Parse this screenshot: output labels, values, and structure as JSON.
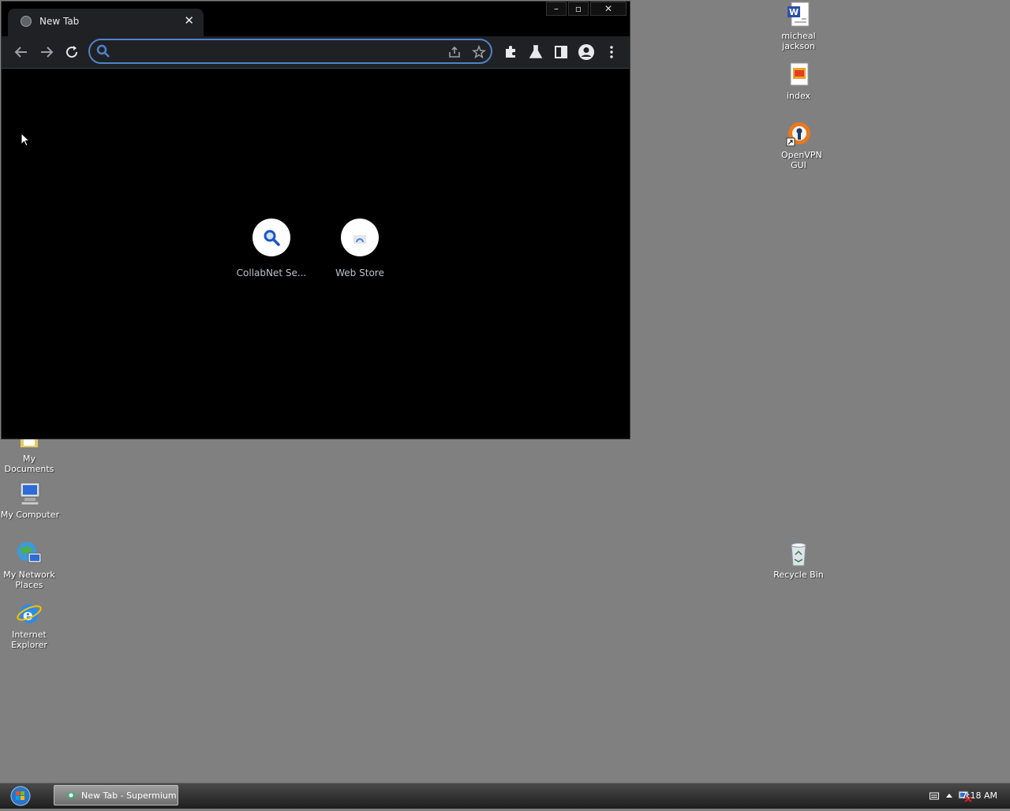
{
  "browser": {
    "tab_title": "New Tab",
    "omnibox_value": "",
    "shortcuts": [
      {
        "label": "CollabNet Se...",
        "icon": "magnifier-icon"
      },
      {
        "label": "Web Store",
        "icon": "web-store-icon"
      }
    ]
  },
  "desktop": {
    "icons": [
      {
        "label": "micheal jackson",
        "icon": "word-document-icon"
      },
      {
        "label": "index",
        "icon": "html-file-icon"
      },
      {
        "label": "OpenVPN GUI",
        "icon": "openvpn-icon"
      },
      {
        "label": "My Documents",
        "icon": "folder-icon"
      },
      {
        "label": "My Computer",
        "icon": "computer-icon"
      },
      {
        "label": "My Network Places",
        "icon": "network-icon"
      },
      {
        "label": "Internet Explorer",
        "icon": "ie-icon"
      },
      {
        "label": "Recycle Bin",
        "icon": "recycle-bin-icon"
      }
    ]
  },
  "taskbar": {
    "task_label": "New Tab - Supermium",
    "clock": "7:18 AM"
  }
}
